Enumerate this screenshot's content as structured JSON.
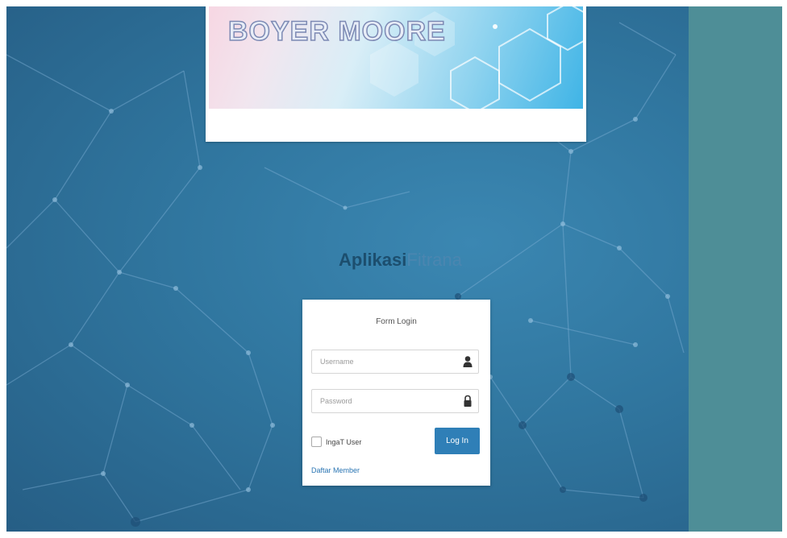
{
  "banner": {
    "title": "BOYER MOORE"
  },
  "app": {
    "title_bold": "Aplikasi",
    "title_light": "Fitrana"
  },
  "login": {
    "form_title": "Form Login",
    "username_placeholder": "Username",
    "password_placeholder": "Password",
    "username_icon": "user-icon",
    "password_icon": "lock-icon",
    "remember_label": "IngaT User",
    "remember_checked": false,
    "login_button": "Log In",
    "register_link": "Daftar Member"
  },
  "colors": {
    "background": "#2f739c",
    "right_panel": "#4e8e97",
    "login_button": "#2f7fb7",
    "link": "#2a75b3"
  }
}
